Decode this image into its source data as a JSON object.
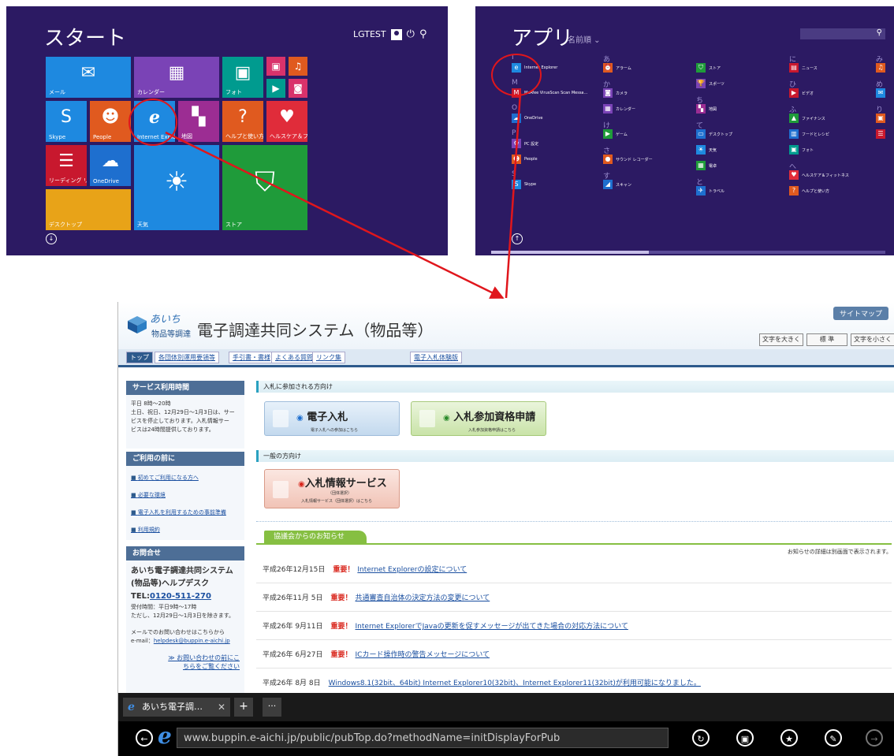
{
  "start_screen": {
    "title": "スタート",
    "user": "LGTEST",
    "tiles": [
      {
        "label": "メール",
        "glyph": "✉",
        "color": "#1e89e0"
      },
      {
        "label": "カレンダー",
        "glyph": "▦",
        "color": "#7a43b6"
      },
      {
        "label": "フォト",
        "glyph": "▣",
        "color": "#009b8f"
      },
      {
        "label": "",
        "glyph": "▣",
        "color": "#d9326b"
      },
      {
        "label": "",
        "glyph": "♫",
        "color": "#e05a1f"
      },
      {
        "label": "",
        "glyph": "▶",
        "color": "#009b8f"
      },
      {
        "label": "",
        "glyph": "◙",
        "color": "#d9326b"
      },
      {
        "label": "Skype",
        "glyph": "S",
        "color": "#1e89e0"
      },
      {
        "label": "People",
        "glyph": "☻",
        "color": "#e05a1f"
      },
      {
        "label": "Internet Explorer",
        "glyph": "e",
        "color": "#1e89e0"
      },
      {
        "label": "地図",
        "glyph": "▚",
        "color": "#9c2d93"
      },
      {
        "label": "ヘルプと使い方",
        "glyph": "?",
        "color": "#e05a1f"
      },
      {
        "label": "ヘルスケア＆フィットネス",
        "glyph": "♥",
        "color": "#e02c3a"
      },
      {
        "label": "リーディング リスト",
        "glyph": "☰",
        "color": "#c8182e"
      },
      {
        "label": "OneDrive",
        "glyph": "☁",
        "color": "#1e6fcf"
      },
      {
        "label": "天気",
        "glyph": "☀",
        "color": "#1e89e0"
      },
      {
        "label": "ストア",
        "glyph": "⛉",
        "color": "#1f9b3a"
      },
      {
        "label": "デスクトップ",
        "glyph": "",
        "color": "#e8a318"
      }
    ]
  },
  "apps_view": {
    "title": "アプリ",
    "sort": "名前順",
    "columns": [
      {
        "items": [
          {
            "hdr": "I"
          },
          {
            "name": "Internet Explorer",
            "color": "#1e89e0",
            "glyph": "e"
          },
          {
            "hdr": "M"
          },
          {
            "name": "McAfee VirusScan Scan Messa...",
            "color": "#c8182e",
            "glyph": "M"
          },
          {
            "hdr": "O"
          },
          {
            "name": "OneDrive",
            "color": "#1e6fcf",
            "glyph": "☁"
          },
          {
            "hdr": "P"
          },
          {
            "name": "PC 設定",
            "color": "#7a43b6",
            "glyph": "⚙"
          },
          {
            "name": "People",
            "color": "#e05a1f",
            "glyph": "☻"
          },
          {
            "hdr": "S"
          },
          {
            "name": "Skype",
            "color": "#1e89e0",
            "glyph": "S"
          }
        ]
      },
      {
        "items": [
          {
            "hdr": "あ"
          },
          {
            "name": "アラーム",
            "color": "#e05a1f",
            "glyph": "⏰"
          },
          {
            "hdr": "か"
          },
          {
            "name": "カメラ",
            "color": "#7a43b6",
            "glyph": "◙"
          },
          {
            "name": "カレンダー",
            "color": "#7a43b6",
            "glyph": "▦"
          },
          {
            "hdr": "け"
          },
          {
            "name": "ゲーム",
            "color": "#1f9b3a",
            "glyph": "▶"
          },
          {
            "hdr": "さ"
          },
          {
            "name": "サウンド レコーダー",
            "color": "#e05a1f",
            "glyph": "●"
          },
          {
            "hdr": "す"
          },
          {
            "name": "スキャン",
            "color": "#1e6fcf",
            "glyph": "◢"
          }
        ]
      },
      {
        "items": [
          {
            "hdr": ""
          },
          {
            "name": "ストア",
            "color": "#1f9b3a",
            "glyph": "⛉"
          },
          {
            "name": "スポーツ",
            "color": "#7a43b6",
            "glyph": "🏆"
          },
          {
            "hdr": "ち"
          },
          {
            "name": "地図",
            "color": "#9c2d93",
            "glyph": "▚"
          },
          {
            "hdr": "て"
          },
          {
            "name": "デスクトップ",
            "color": "#1e6fcf",
            "glyph": "▭"
          },
          {
            "name": "天気",
            "color": "#1e89e0",
            "glyph": "☀"
          },
          {
            "name": "電卓",
            "color": "#1f9b3a",
            "glyph": "▦"
          },
          {
            "hdr": "と"
          },
          {
            "name": "トラベル",
            "color": "#1e6fcf",
            "glyph": "✈"
          }
        ]
      },
      {
        "items": [
          {
            "hdr": "に"
          },
          {
            "name": "ニュース",
            "color": "#c8182e",
            "glyph": "▤"
          },
          {
            "hdr": "ひ"
          },
          {
            "name": "ビデオ",
            "color": "#c8182e",
            "glyph": "▶"
          },
          {
            "hdr": "ふ"
          },
          {
            "name": "ファイナンス",
            "color": "#1f9b3a",
            "glyph": "▲"
          },
          {
            "name": "フードとレシピ",
            "color": "#1e6fcf",
            "glyph": "▥"
          },
          {
            "name": "フォト",
            "color": "#009b8f",
            "glyph": "▣"
          },
          {
            "hdr": "へ"
          },
          {
            "name": "ヘルスケア＆フィットネス",
            "color": "#e02c3a",
            "glyph": "♥"
          },
          {
            "name": "ヘルプと使い方",
            "color": "#e05a1f",
            "glyph": "?"
          }
        ]
      },
      {
        "items": [
          {
            "hdr": "み"
          },
          {
            "name": "",
            "color": "#e05a1f",
            "glyph": "♫"
          },
          {
            "hdr": "め"
          },
          {
            "name": "",
            "color": "#1e89e0",
            "glyph": "✉"
          },
          {
            "hdr": "り"
          },
          {
            "name": "",
            "color": "#e05a1f",
            "glyph": "▣"
          },
          {
            "name": "",
            "color": "#c8182e",
            "glyph": "☰"
          }
        ]
      }
    ]
  },
  "site": {
    "logo_line1": "あいち",
    "logo_line2": "物品等調達",
    "title": "電子調達共同システム（物品等）",
    "sitemap": "サイトマップ",
    "font_buttons": [
      "文字を大きく",
      "標 準",
      "文字を小さく"
    ],
    "nav": [
      "トップ",
      "各団体別運用要領等",
      "手引書・書様",
      "よくある質問",
      "リンク集",
      "電子入札体験版"
    ],
    "left": {
      "service_hdr": "サービス利用時間",
      "service_body": [
        "平日 8時～20時",
        "土日、祝日、12月29日～1月3日は、サー",
        "ビスを停止しております。入札情報サー",
        "ビスは24時間提供しております。"
      ],
      "before_hdr": "ご利用の前に",
      "before_links": [
        "初めてご利用になる方へ",
        "必要な環境",
        "電子入札を利用するための事前準備",
        "利用規約"
      ],
      "contact_hdr": "お問合せ",
      "contact_name1": "あいち電子調達共同システム",
      "contact_name2": "(物品等)ヘルプデスク",
      "tel_label": "TEL:",
      "tel": "0120-511-270",
      "hours1": "受付時間：平日9時～17時",
      "hours2": "ただし、12月29日～1月3日を除きます。",
      "mail_intro": "メールでのお問い合わせはこちらから",
      "mail_label": "e-mail：",
      "mail": "helpdesk@buppin.e-aichi.jp",
      "contact_more1": "≫ お問い合わせの前にこ",
      "contact_more2": "ちらをご覧ください"
    },
    "main": {
      "bidder_hdr": "入札に参加される方向け",
      "btn_ebid_title": "電子入札",
      "btn_ebid_sub": "電子入札への参加はこちら",
      "btn_qual_title": "入札参加資格申請",
      "btn_qual_sub": "入札参加資格申請はこちら",
      "general_hdr": "一般の方向け",
      "btn_info_title": "入札情報サービス",
      "btn_info_paren": "（団体選択）",
      "btn_info_sub": "入札情報サービス（団体選択）はこちら",
      "news_tab": "協議会からのお知らせ",
      "news_note": "お知らせの詳細は別画面で表示されます。",
      "important": "重要！",
      "news": [
        {
          "date": "平成26年12月15日",
          "important": true,
          "text": "Internet Explorerの設定について"
        },
        {
          "date": "平成26年11月 5日",
          "important": true,
          "text": "共通審査自治体の決定方法の変更について"
        },
        {
          "date": "平成26年 9月11日",
          "important": true,
          "text": "Internet ExplorerでJavaの更新を促すメッセージが出てきた場合の対応方法について"
        },
        {
          "date": "平成26年 6月27日",
          "important": true,
          "text": "ICカード操作時の警告メッセージについて"
        },
        {
          "date": "平成26年 8月 8日",
          "important": false,
          "text": "Windows8.1(32bit、64bit) Internet Explorer10(32bit)、Internet Explorer11(32bit)が利用可能になりました。"
        }
      ]
    }
  },
  "ie_ui": {
    "tab_title": "あいち電子調…",
    "url": "www.buppin.e-aichi.jp/public/pubTop.do?methodName=initDisplayForPub"
  }
}
